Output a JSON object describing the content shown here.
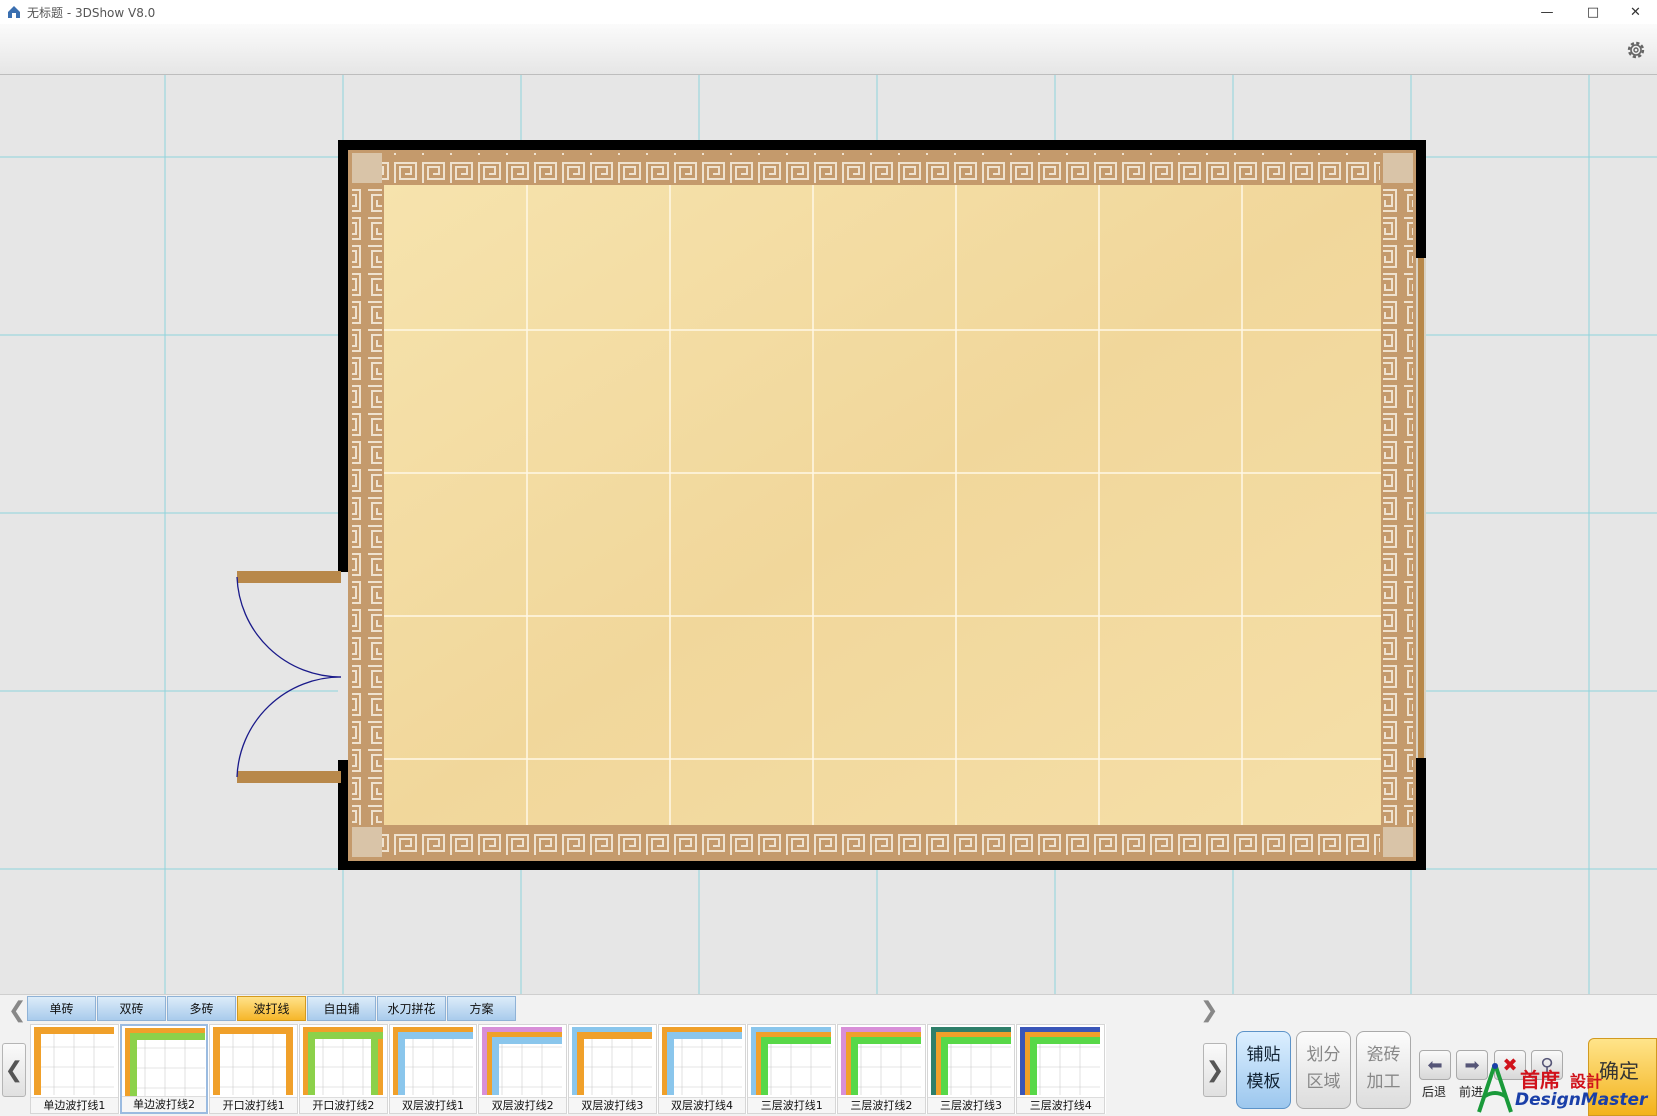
{
  "window": {
    "title": "无标题 - 3DShow V8.0",
    "controls": [
      "minimize",
      "maximize",
      "close"
    ]
  },
  "toolbar": {
    "settings_icon": "gear-icon"
  },
  "tabs": {
    "items": [
      {
        "label": "单砖",
        "active": false
      },
      {
        "label": "双砖",
        "active": false
      },
      {
        "label": "多砖",
        "active": false
      },
      {
        "label": "波打线",
        "active": true
      },
      {
        "label": "自由铺",
        "active": false
      },
      {
        "label": "水刀拼花",
        "active": false
      },
      {
        "label": "方案",
        "active": false
      }
    ]
  },
  "templates": [
    {
      "label": "单边波打线1",
      "style": "single1"
    },
    {
      "label": "单边波打线2",
      "style": "single2",
      "selected": true
    },
    {
      "label": "开口波打线1",
      "style": "open1"
    },
    {
      "label": "开口波打线2",
      "style": "open2"
    },
    {
      "label": "双层波打线1",
      "style": "double1"
    },
    {
      "label": "双层波打线2",
      "style": "double2"
    },
    {
      "label": "双层波打线3",
      "style": "double3"
    },
    {
      "label": "双层波打线4",
      "style": "double4"
    },
    {
      "label": "三层波打线1",
      "style": "triple1"
    },
    {
      "label": "三层波打线2",
      "style": "triple2"
    },
    {
      "label": "三层波打线3",
      "style": "triple3"
    },
    {
      "label": "三层波打线4",
      "style": "triple4"
    }
  ],
  "side_buttons": {
    "paste_template": {
      "line1": "铺贴",
      "line2": "模板"
    },
    "divide_area": {
      "line1": "划分",
      "line2": "区域"
    },
    "tile_process": {
      "line1": "瓷砖",
      "line2": "加工"
    }
  },
  "actions": {
    "back_label": "后退",
    "forward_label": "前进",
    "confirm_label": "确定"
  },
  "logo": {
    "cn": "首席",
    "cn2": "設計",
    "en": "DesignMaster"
  },
  "colors": {
    "floor_tile": "#f3dca2",
    "border_tile": "#c9a27a",
    "wall": "#000000",
    "door": "#b8884a",
    "grid": "#8fd4dc",
    "tab_active": "#f6b62a",
    "tab_inactive": "#a9cbec"
  }
}
